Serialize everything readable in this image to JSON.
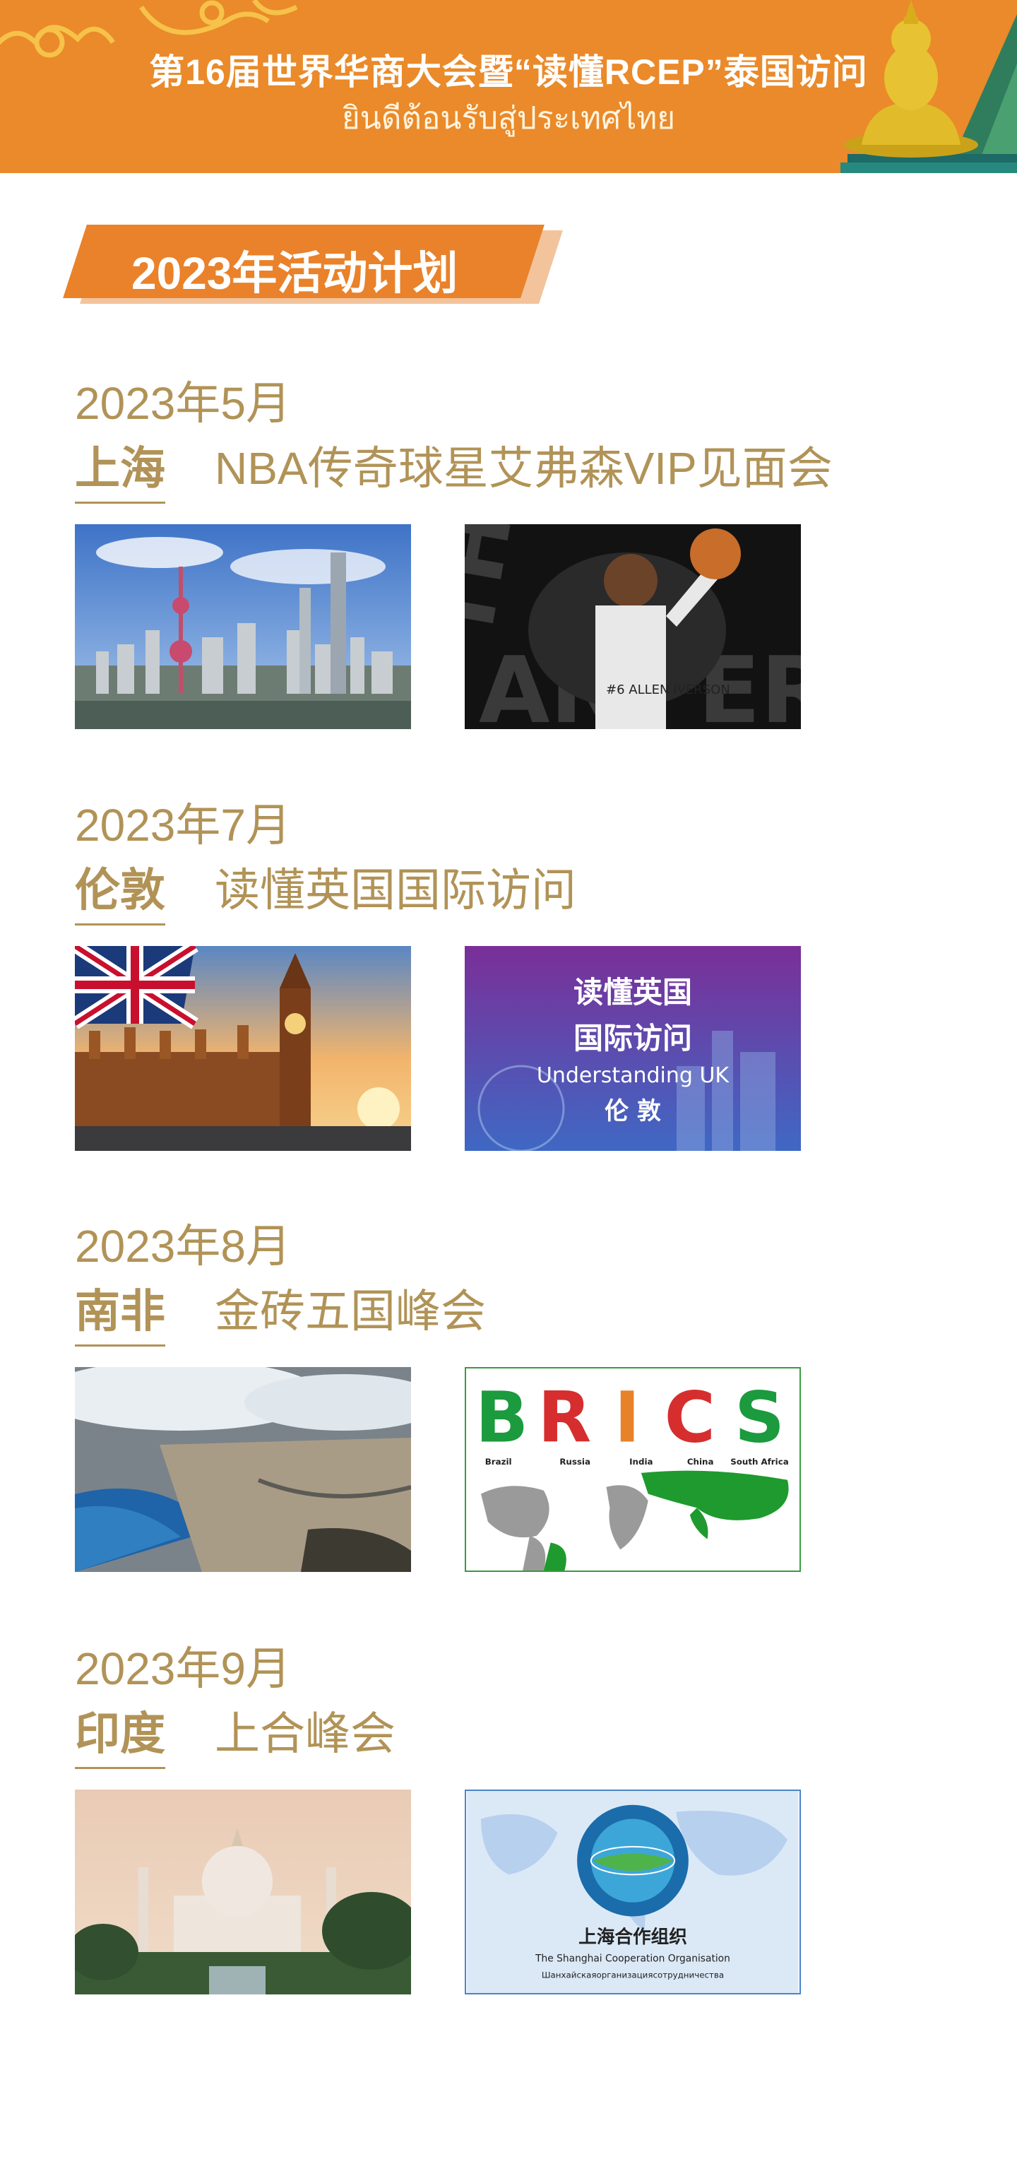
{
  "header": {
    "title": "第16届世界华商大会暨“读懂RCEP”泰国访问",
    "subtitle": "ยินดีต้อนรับสู่ประเทศไทย"
  },
  "section": {
    "title": "2023年活动计划"
  },
  "events": [
    {
      "date": "2023年5月",
      "city": "上海",
      "name": "NBA传奇球星艾弗森VIP见面会",
      "images": [
        {
          "subject": "shanghai-skyline",
          "text": ""
        },
        {
          "subject": "iverson-poster",
          "text": "THE ANSWER",
          "jersey": "#6 ALLEN IVERSON"
        }
      ]
    },
    {
      "date": "2023年7月",
      "city": "伦敦",
      "name": "读懂英国国际访问",
      "images": [
        {
          "subject": "big-ben-london",
          "text": ""
        },
        {
          "subject": "understanding-uk-poster",
          "line1": "读懂英国",
          "line2": "国际访问",
          "line3": "Understanding  UK",
          "line4": "伦 敦"
        }
      ]
    },
    {
      "date": "2023年8月",
      "city": "南非",
      "name": "金砖五国峰会",
      "images": [
        {
          "subject": "cape-town-aerial",
          "text": ""
        },
        {
          "subject": "brics-map",
          "letters": [
            "B",
            "R",
            "I",
            "C",
            "S"
          ],
          "countries": [
            "Brazil",
            "Russia",
            "India",
            "China",
            "South Africa"
          ]
        }
      ]
    },
    {
      "date": "2023年9月",
      "city": "印度",
      "name": "上合峰会",
      "images": [
        {
          "subject": "taj-mahal",
          "text": ""
        },
        {
          "subject": "sco-logo",
          "line1": "上海合作组织",
          "line2": "The Shanghai Cooperation Organisation",
          "line3": "Шанхайскаяорганизациясотрудничества"
        }
      ]
    }
  ],
  "colors": {
    "header_bg": "#ea8a2a",
    "accent_gold": "#b19357",
    "banner_orange": "#e9822a"
  }
}
